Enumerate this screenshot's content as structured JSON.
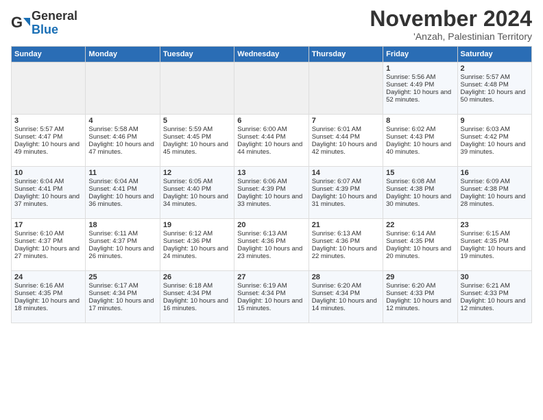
{
  "header": {
    "logo_general": "General",
    "logo_blue": "Blue",
    "month": "November 2024",
    "location": "'Anzah, Palestinian Territory"
  },
  "days_of_week": [
    "Sunday",
    "Monday",
    "Tuesday",
    "Wednesday",
    "Thursday",
    "Friday",
    "Saturday"
  ],
  "weeks": [
    [
      {
        "day": "",
        "empty": true
      },
      {
        "day": "",
        "empty": true
      },
      {
        "day": "",
        "empty": true
      },
      {
        "day": "",
        "empty": true
      },
      {
        "day": "",
        "empty": true
      },
      {
        "day": "1",
        "sunrise": "Sunrise: 5:56 AM",
        "sunset": "Sunset: 4:49 PM",
        "daylight": "Daylight: 10 hours and 52 minutes."
      },
      {
        "day": "2",
        "sunrise": "Sunrise: 5:57 AM",
        "sunset": "Sunset: 4:48 PM",
        "daylight": "Daylight: 10 hours and 50 minutes."
      }
    ],
    [
      {
        "day": "3",
        "sunrise": "Sunrise: 5:57 AM",
        "sunset": "Sunset: 4:47 PM",
        "daylight": "Daylight: 10 hours and 49 minutes."
      },
      {
        "day": "4",
        "sunrise": "Sunrise: 5:58 AM",
        "sunset": "Sunset: 4:46 PM",
        "daylight": "Daylight: 10 hours and 47 minutes."
      },
      {
        "day": "5",
        "sunrise": "Sunrise: 5:59 AM",
        "sunset": "Sunset: 4:45 PM",
        "daylight": "Daylight: 10 hours and 45 minutes."
      },
      {
        "day": "6",
        "sunrise": "Sunrise: 6:00 AM",
        "sunset": "Sunset: 4:44 PM",
        "daylight": "Daylight: 10 hours and 44 minutes."
      },
      {
        "day": "7",
        "sunrise": "Sunrise: 6:01 AM",
        "sunset": "Sunset: 4:44 PM",
        "daylight": "Daylight: 10 hours and 42 minutes."
      },
      {
        "day": "8",
        "sunrise": "Sunrise: 6:02 AM",
        "sunset": "Sunset: 4:43 PM",
        "daylight": "Daylight: 10 hours and 40 minutes."
      },
      {
        "day": "9",
        "sunrise": "Sunrise: 6:03 AM",
        "sunset": "Sunset: 4:42 PM",
        "daylight": "Daylight: 10 hours and 39 minutes."
      }
    ],
    [
      {
        "day": "10",
        "sunrise": "Sunrise: 6:04 AM",
        "sunset": "Sunset: 4:41 PM",
        "daylight": "Daylight: 10 hours and 37 minutes."
      },
      {
        "day": "11",
        "sunrise": "Sunrise: 6:04 AM",
        "sunset": "Sunset: 4:41 PM",
        "daylight": "Daylight: 10 hours and 36 minutes."
      },
      {
        "day": "12",
        "sunrise": "Sunrise: 6:05 AM",
        "sunset": "Sunset: 4:40 PM",
        "daylight": "Daylight: 10 hours and 34 minutes."
      },
      {
        "day": "13",
        "sunrise": "Sunrise: 6:06 AM",
        "sunset": "Sunset: 4:39 PM",
        "daylight": "Daylight: 10 hours and 33 minutes."
      },
      {
        "day": "14",
        "sunrise": "Sunrise: 6:07 AM",
        "sunset": "Sunset: 4:39 PM",
        "daylight": "Daylight: 10 hours and 31 minutes."
      },
      {
        "day": "15",
        "sunrise": "Sunrise: 6:08 AM",
        "sunset": "Sunset: 4:38 PM",
        "daylight": "Daylight: 10 hours and 30 minutes."
      },
      {
        "day": "16",
        "sunrise": "Sunrise: 6:09 AM",
        "sunset": "Sunset: 4:38 PM",
        "daylight": "Daylight: 10 hours and 28 minutes."
      }
    ],
    [
      {
        "day": "17",
        "sunrise": "Sunrise: 6:10 AM",
        "sunset": "Sunset: 4:37 PM",
        "daylight": "Daylight: 10 hours and 27 minutes."
      },
      {
        "day": "18",
        "sunrise": "Sunrise: 6:11 AM",
        "sunset": "Sunset: 4:37 PM",
        "daylight": "Daylight: 10 hours and 26 minutes."
      },
      {
        "day": "19",
        "sunrise": "Sunrise: 6:12 AM",
        "sunset": "Sunset: 4:36 PM",
        "daylight": "Daylight: 10 hours and 24 minutes."
      },
      {
        "day": "20",
        "sunrise": "Sunrise: 6:13 AM",
        "sunset": "Sunset: 4:36 PM",
        "daylight": "Daylight: 10 hours and 23 minutes."
      },
      {
        "day": "21",
        "sunrise": "Sunrise: 6:13 AM",
        "sunset": "Sunset: 4:36 PM",
        "daylight": "Daylight: 10 hours and 22 minutes."
      },
      {
        "day": "22",
        "sunrise": "Sunrise: 6:14 AM",
        "sunset": "Sunset: 4:35 PM",
        "daylight": "Daylight: 10 hours and 20 minutes."
      },
      {
        "day": "23",
        "sunrise": "Sunrise: 6:15 AM",
        "sunset": "Sunset: 4:35 PM",
        "daylight": "Daylight: 10 hours and 19 minutes."
      }
    ],
    [
      {
        "day": "24",
        "sunrise": "Sunrise: 6:16 AM",
        "sunset": "Sunset: 4:35 PM",
        "daylight": "Daylight: 10 hours and 18 minutes."
      },
      {
        "day": "25",
        "sunrise": "Sunrise: 6:17 AM",
        "sunset": "Sunset: 4:34 PM",
        "daylight": "Daylight: 10 hours and 17 minutes."
      },
      {
        "day": "26",
        "sunrise": "Sunrise: 6:18 AM",
        "sunset": "Sunset: 4:34 PM",
        "daylight": "Daylight: 10 hours and 16 minutes."
      },
      {
        "day": "27",
        "sunrise": "Sunrise: 6:19 AM",
        "sunset": "Sunset: 4:34 PM",
        "daylight": "Daylight: 10 hours and 15 minutes."
      },
      {
        "day": "28",
        "sunrise": "Sunrise: 6:20 AM",
        "sunset": "Sunset: 4:34 PM",
        "daylight": "Daylight: 10 hours and 14 minutes."
      },
      {
        "day": "29",
        "sunrise": "Sunrise: 6:20 AM",
        "sunset": "Sunset: 4:33 PM",
        "daylight": "Daylight: 10 hours and 12 minutes."
      },
      {
        "day": "30",
        "sunrise": "Sunrise: 6:21 AM",
        "sunset": "Sunset: 4:33 PM",
        "daylight": "Daylight: 10 hours and 12 minutes."
      }
    ]
  ]
}
